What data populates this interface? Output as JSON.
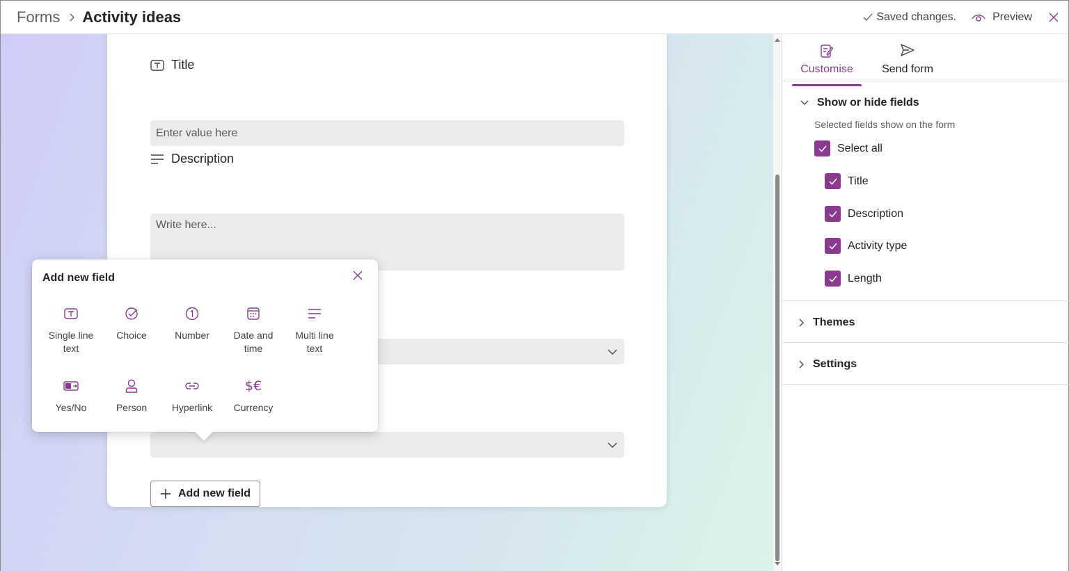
{
  "breadcrumb": {
    "root": "Forms",
    "current": "Activity ideas"
  },
  "topbar": {
    "saved_text": "Saved changes.",
    "preview_label": "Preview"
  },
  "form": {
    "fields": [
      {
        "label": "Title",
        "placeholder": "Enter value here",
        "icon": "text-field-icon"
      },
      {
        "label": "Description",
        "placeholder": "Write here...",
        "icon": "multiline-text-icon"
      }
    ],
    "add_field_label": "Add new field"
  },
  "popup": {
    "title": "Add new field",
    "types": [
      {
        "label": "Single line text",
        "icon": "single-line-text-icon"
      },
      {
        "label": "Choice",
        "icon": "choice-icon"
      },
      {
        "label": "Number",
        "icon": "number-icon"
      },
      {
        "label": "Date and time",
        "icon": "calendar-icon"
      },
      {
        "label": "Multi line text",
        "icon": "multiline-text-icon"
      },
      {
        "label": "Yes/No",
        "icon": "yes-no-icon"
      },
      {
        "label": "Person",
        "icon": "person-icon"
      },
      {
        "label": "Hyperlink",
        "icon": "link-icon"
      },
      {
        "label": "Currency",
        "icon": "currency-icon"
      }
    ]
  },
  "panel": {
    "tabs": [
      {
        "label": "Customise",
        "icon": "customise-icon",
        "active": true
      },
      {
        "label": "Send form",
        "icon": "send-icon",
        "active": false
      }
    ],
    "show_hide": {
      "title": "Show or hide fields",
      "subtitle": "Selected fields show on the form",
      "select_all": "Select all",
      "fields": [
        "Title",
        "Description",
        "Activity type",
        "Length"
      ]
    },
    "themes": "Themes",
    "settings": "Settings"
  },
  "colors": {
    "accent": "#8a3b8f",
    "input_bg": "#ebebeb"
  }
}
